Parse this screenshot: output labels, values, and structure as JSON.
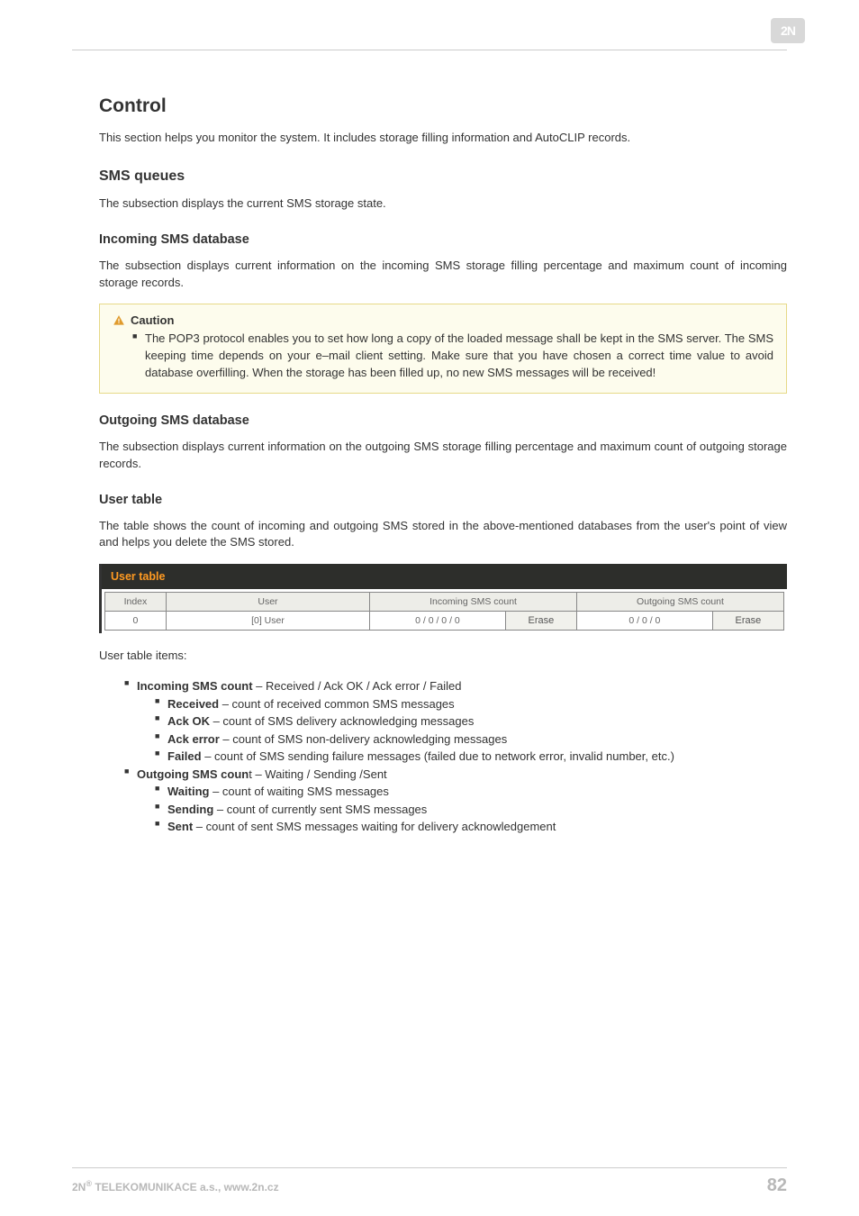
{
  "logo": "2N",
  "h_control": "Control",
  "p_control": "This section helps you monitor the system. It includes storage filling information and AutoCLIP records.",
  "h_sms_queues": "SMS queues",
  "p_sms_queues": "The subsection displays the current SMS storage state.",
  "h_incoming_db": "Incoming SMS database",
  "p_incoming_db": "The subsection displays current information on the incoming SMS storage filling percentage and maximum count of incoming storage records.",
  "caution": {
    "title": "Caution",
    "item": "The POP3 protocol enables you to set how long a copy of the loaded message shall be kept in the SMS server. The SMS keeping time depends on your e–mail client setting. Make sure that you have chosen a correct time value to avoid database overfilling. When the storage has been filled up, no new SMS messages will be received!"
  },
  "h_outgoing_db": "Outgoing SMS database",
  "p_outgoing_db": "The subsection displays current information on the outgoing SMS storage filling percentage and maximum count of outgoing storage records.",
  "h_user_table": "User table",
  "p_user_table": "The table shows the count of incoming and outgoing SMS stored in the above-mentioned databases from the user's point of view and helps you delete the SMS stored.",
  "ut": {
    "title": "User table",
    "headers": {
      "index": "Index",
      "user": "User",
      "incoming": "Incoming SMS count",
      "outgoing": "Outgoing SMS count"
    },
    "row": {
      "index": "0",
      "user": "[0] User",
      "incoming": "0 / 0 / 0 / 0",
      "erase1": "Erase",
      "outgoing": "0 / 0 / 0",
      "erase2": "Erase"
    }
  },
  "p_items": "User table items:",
  "list": {
    "l1_head_b": "Incoming SMS count",
    "l1_head_t": " – Received / Ack OK / Ack error / Failed",
    "l1_1_b": "Received",
    "l1_1_t": " – count of received common SMS messages",
    "l1_2_b": "Ack OK",
    "l1_2_t": " – count of SMS delivery acknowledging messages",
    "l1_3_b": "Ack error",
    "l1_3_t": " – count of SMS non-delivery acknowledging messages",
    "l1_4_b": "Failed",
    "l1_4_t": " – count of SMS sending failure messages (failed due to network error, invalid number, etc.)",
    "l2_head_b": "Outgoing SMS coun",
    "l2_head_t": "t – Waiting / Sending /Sent",
    "l2_1_b": "Waiting",
    "l2_1_t": " – count of waiting SMS messages",
    "l2_2_b": "Sending",
    "l2_2_t": " – count of currently sent SMS messages",
    "l2_3_b": "Sent",
    "l2_3_t": " – count of sent SMS messages waiting for delivery acknowledgement"
  },
  "footer": {
    "left_pre": "2N",
    "left_sup": "®",
    "left_post": " TELEKOMUNIKACE a.s., www.2n.cz",
    "page": "82"
  }
}
